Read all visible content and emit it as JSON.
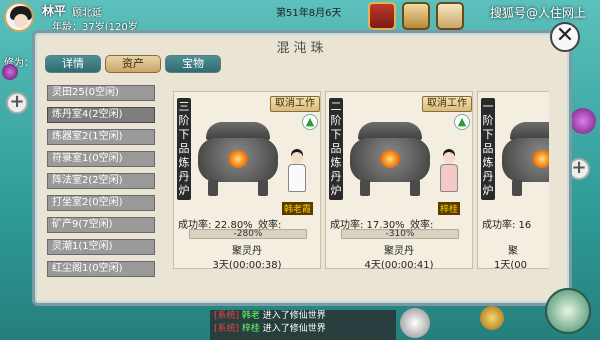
{
  "player": {
    "name": "林平",
    "location": "顾北延",
    "age_text": "年龄：37岁(120岁"
  },
  "game_date": "第51年8月6天",
  "watermark": "搜狐号@人住网上",
  "cultivation_label": "修为：",
  "panel": {
    "title": "混沌珠",
    "tabs": [
      {
        "label": "详情",
        "active": false
      },
      {
        "label": "资产",
        "active": true
      },
      {
        "label": "宝物",
        "active": false
      }
    ],
    "buildings": [
      {
        "label": "灵田25(0空闲)",
        "selected": false
      },
      {
        "label": "炼丹室4(2空闲)",
        "selected": true
      },
      {
        "label": "炼器室2(1空闲)",
        "selected": false
      },
      {
        "label": "符箓室1(0空闲)",
        "selected": false
      },
      {
        "label": "阵法室2(2空闲)",
        "selected": false
      },
      {
        "label": "打坐室2(0空闲)",
        "selected": false
      },
      {
        "label": "矿产9(7空闲)",
        "selected": false
      },
      {
        "label": "灵潮1(1空闲)",
        "selected": false
      },
      {
        "label": "红尘阁1(0空闲)",
        "selected": false
      }
    ],
    "furnaces": [
      {
        "title_chars": [
          "三",
          "阶",
          "下",
          "品",
          "炼",
          "丹",
          "炉"
        ],
        "cancel_label": "取消工作",
        "worker": "韩老霞",
        "success_rate": "成功率: 22.80%",
        "efficiency": "效率: 48.00%",
        "progress_text": "-280%",
        "product": "聚灵丹",
        "time_left": "3天(00:00:38)",
        "worker_style": "white"
      },
      {
        "title_chars": [
          "二",
          "阶",
          "下",
          "品",
          "炼",
          "丹",
          "炉"
        ],
        "cancel_label": "取消工作",
        "worker": "梓桂",
        "success_rate": "成功率: 17.30%",
        "efficiency": "效率: 23.00%",
        "progress_text": "-310%",
        "product": "聚灵丹",
        "time_left": "4天(00:00:41)",
        "worker_style": "pink"
      },
      {
        "title_chars": [
          "一",
          "阶",
          "下",
          "品",
          "炼",
          "丹",
          "炉"
        ],
        "cancel_label": "",
        "worker": "",
        "success_rate": "成功率: 16",
        "efficiency": "",
        "progress_text": "",
        "product": "聚",
        "time_left": "1天(00",
        "worker_style": "none"
      }
    ]
  },
  "chat": {
    "messages": [
      {
        "tag": "[系统]",
        "who": "韩老",
        "text": "进入了修仙世界"
      },
      {
        "tag": "[系统]",
        "who": "梓桂",
        "text": "进入了修仙世界"
      }
    ]
  },
  "colors": {
    "accent_teal": "#2f6c72",
    "tab_active": "#c9a56a",
    "npc_name": "#f6d400",
    "upgrade_green": "#2e9a3a"
  },
  "icons": [
    "close-icon",
    "plus-icon",
    "upgrade-arrow-icon",
    "treasure-chest-icon",
    "scroll-icon",
    "sword-icon"
  ]
}
